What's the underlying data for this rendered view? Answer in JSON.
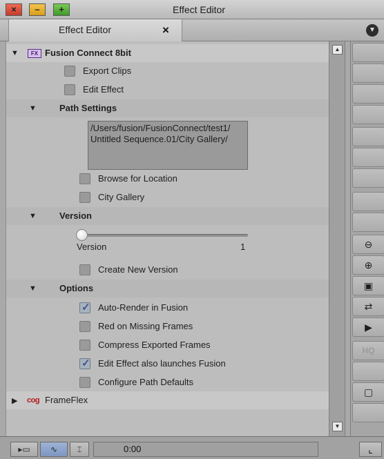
{
  "window": {
    "title": "Effect Editor"
  },
  "tab": {
    "label": "Effect Editor",
    "close_glyph": "×"
  },
  "effects": [
    {
      "name": "Fusion Connect 8bit",
      "icon": "fusion-icon",
      "expanded": true
    },
    {
      "name": "FrameFlex",
      "icon": "cog-icon",
      "expanded": false
    }
  ],
  "fusion": {
    "export_clips": {
      "label": "Export Clips",
      "checked": false
    },
    "edit_effect": {
      "label": "Edit Effect",
      "checked": false
    },
    "path_settings": {
      "title": "Path Settings",
      "path_line1": "/Users/fusion/FusionConnect/test1/",
      "path_line2": "Untitled Sequence.01/City Gallery/",
      "browse": {
        "label": "Browse for Location",
        "checked": false
      },
      "city_gallery": {
        "label": "City Gallery",
        "checked": false
      }
    },
    "version": {
      "title": "Version",
      "slider_label": "Version",
      "slider_value": "1",
      "create_new": {
        "label": "Create New Version",
        "checked": false
      }
    },
    "options": {
      "title": "Options",
      "items": [
        {
          "label": "Auto-Render in Fusion",
          "checked": true
        },
        {
          "label": "Red on Missing Frames",
          "checked": false
        },
        {
          "label": "Compress Exported Frames",
          "checked": false
        },
        {
          "label": "Edit Effect also launches Fusion",
          "checked": true
        },
        {
          "label": "Configure Path Defaults",
          "checked": false
        }
      ]
    }
  },
  "frameflex_icon_text": "cog",
  "right_toolbar": {
    "icons": [
      "zoom-out-icon",
      "zoom-in-icon",
      "fit-frame-icon",
      "swap-icon",
      "play-icon",
      "hq-label",
      "monitor-icon"
    ],
    "hq_label": "HQ"
  },
  "bottom": {
    "timecode": "0:00",
    "buttons": [
      "track-icon",
      "waveform-icon",
      "in-out-icon"
    ]
  },
  "colors": {
    "checkmark": "#3b5a86",
    "fusion_icon": "#5a2a86",
    "frameflex_icon": "#b31c1c",
    "active_button": "#8ba4cc"
  }
}
